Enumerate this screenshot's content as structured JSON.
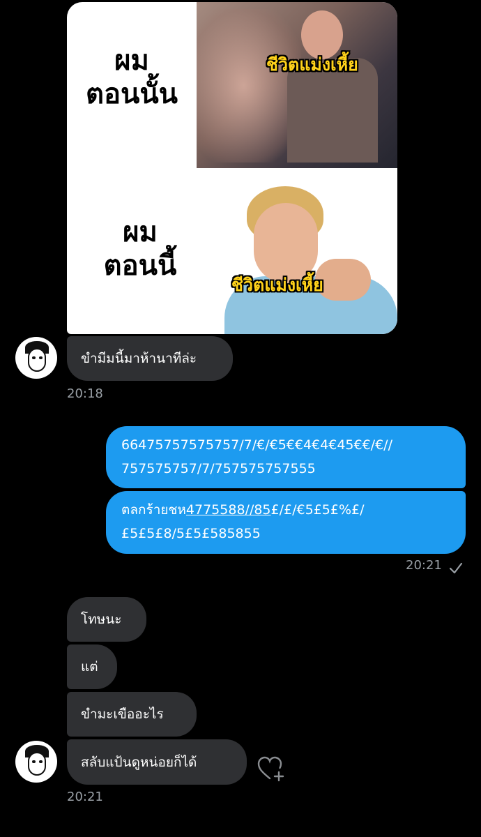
{
  "meme": {
    "top_caption_line1": "ผม",
    "top_caption_line2": "ตอนนั้น",
    "top_overlay": "ชีวิตแม่งเหี้ย",
    "bottom_caption_line1": "ผม",
    "bottom_caption_line2": "ตอนนี้",
    "bottom_overlay": "ชีวิตแม่งเหี้ย"
  },
  "messages": {
    "in1": "ขำมีมนี้มาห้านาทีล่ะ",
    "time1": "20:18",
    "out1_line1": "66475757575757/7/€/€5€€4€4€45€€/€//",
    "out1_line2": "757575757/7/757575757555",
    "out2_prefix": "ตลกร้ายชห",
    "out2_link": "4775588//85",
    "out2_suffix": "£/£/€5£5£%£/",
    "out2_line2": "£5£5£8/5£5£585855",
    "time2": "20:21",
    "in2": "โทษนะ",
    "in3": "แต่",
    "in4": "ขำมะเขืออะไร",
    "in5": "สลับแป้นดูหน่อยก็ได้",
    "time3": "20:21"
  },
  "icons": {
    "read_check": "check-icon",
    "react": "heart-plus-icon"
  }
}
